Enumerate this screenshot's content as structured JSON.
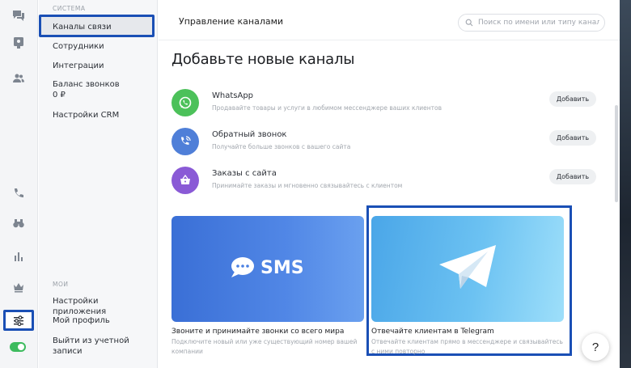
{
  "rail": {
    "icons": [
      "chat-icon",
      "inbox-icon",
      "contacts-icon",
      "phone-icon",
      "binoculars-icon",
      "stats-icon",
      "crown-icon",
      "settings-sliders-icon"
    ]
  },
  "sidebar": {
    "section_system": "СИСТЕМА",
    "items_system": [
      {
        "label": "Каналы связи",
        "selected": true
      },
      {
        "label": "Сотрудники"
      },
      {
        "label": "Интеграции"
      },
      {
        "label": "Баланс звонков"
      },
      {
        "label": "0 ₽"
      },
      {
        "label": "Настройки CRM"
      }
    ],
    "section_mine": "МОИ",
    "items_mine": [
      {
        "label": "Настройки приложения"
      },
      {
        "label": "Мой профиль"
      },
      {
        "label": "Выйти из учетной записи"
      }
    ]
  },
  "header": {
    "title": "Управление каналами",
    "search_placeholder": "Поиск по имени или типу канала"
  },
  "main": {
    "title": "Добавьте новые каналы",
    "add_label": "Добавить",
    "channels": [
      {
        "name": "WhatsApp",
        "desc": "Продавайте товары и услуги в любимом мессенджере ваших клиентов",
        "color": "#4cc15a"
      },
      {
        "name": "Обратный звонок",
        "desc": "Получайте больше звонков с вашего сайта",
        "color": "#4f7fd8"
      },
      {
        "name": "Заказы с сайта",
        "desc": "Принимайте заказы и мгновенно связывайтесь с клиентом",
        "color": "#8a5ad6"
      }
    ],
    "cards": [
      {
        "image_text": "SMS",
        "title": "Звоните и принимайте звонки со всего мира",
        "desc": "Подключите новый или уже существующий номер вашей компании"
      },
      {
        "title": "Отвечайте клиентам в Telegram",
        "desc": "Отвечайте клиентам прямо в мессенджере и связывайтесь с ними повторно"
      }
    ]
  },
  "help_label": "?"
}
